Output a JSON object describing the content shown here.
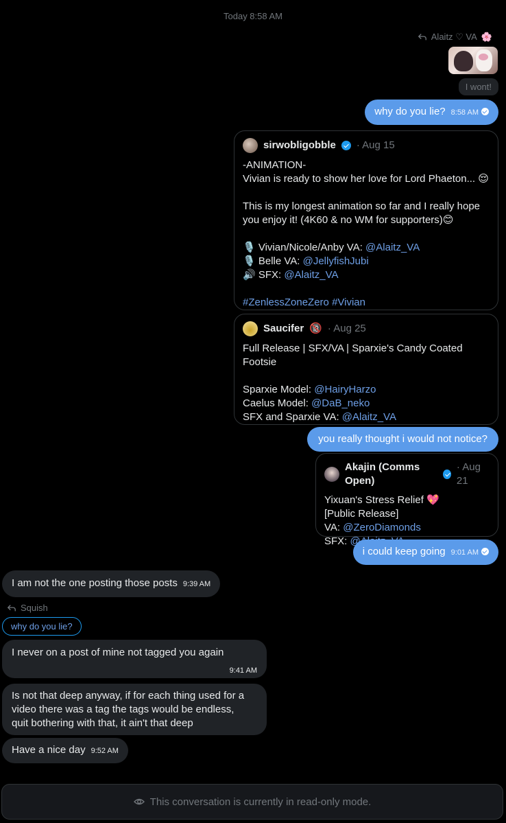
{
  "timestamp_header": "Today 8:58 AM",
  "reply1": {
    "label": "Alaitz ♡ VA",
    "emoji": "🌸",
    "reaction": "I wont!"
  },
  "msg1": {
    "text": "why do you lie?",
    "time": "8:58 AM"
  },
  "card1": {
    "name": "sirwobligobble",
    "date": "· Aug 15",
    "lines": [
      "-ANIMATION-",
      "Vivian is ready to show her love for Lord Phaeton... 😌",
      "",
      "This is my longest animation so far and I really hope",
      "you enjoy it! (4K60 & no WM for supporters)😊",
      "",
      "🎙️ Vivian/Nicole/Anby VA: ",
      "🎙️ Belle VA: ",
      "🔊 SFX: ",
      ""
    ],
    "mentions": [
      "@Alaitz_VA",
      "@JellyfishJubi",
      "@Alaitz_VA"
    ],
    "hashtags": "#ZenlessZoneZero #Vivian"
  },
  "card2": {
    "name": "Saucifer",
    "badge": "🔞",
    "date": "· Aug 25",
    "title1": "Full Release | SFX/VA | Sparxie's Candy Coated",
    "title2": "Footsie",
    "rows": [
      {
        "label": "Sparxie Model: ",
        "mention": "@HairyHarzo"
      },
      {
        "label": "Caelus Model: ",
        "mention": "@DaB_neko"
      },
      {
        "label": "SFX and Sparxie VA: ",
        "mention": "@Alaitz_VA"
      }
    ]
  },
  "msg2": {
    "text": "you really thought i would not notice?"
  },
  "card3": {
    "name": "Akajin (Comms Open)",
    "date": "· Aug 21",
    "line1": "Yixuan's Stress Relief 💖",
    "line2": "[Public Release]",
    "rows": [
      {
        "label": "VA: ",
        "mention": "@ZeroDiamonds"
      },
      {
        "label": "SFX: ",
        "mention": "@Alaitz_VA"
      }
    ]
  },
  "msg3": {
    "text": "i could keep going",
    "time": "9:01 AM"
  },
  "in1": {
    "text": "I am not the one posting those posts",
    "time": "9:39 AM"
  },
  "reply2": {
    "label": "Squish",
    "quote": "why do you lie?"
  },
  "in2": {
    "text": "I never on a post of mine not tagged you again",
    "time": "9:41 AM"
  },
  "in3": {
    "lines": [
      "Is not that deep anyway, if for each thing used for a",
      "video there was a tag the tags would be endless,",
      "quit bothering with that, it ain't that deep"
    ]
  },
  "in4": {
    "text": "Have a nice day",
    "time": "9:52 AM"
  },
  "footer": {
    "text": "This conversation is currently in read-only mode."
  },
  "colors": {
    "outgoing": "#5b9bea",
    "incoming": "#202327",
    "link": "#6e9fe6",
    "background": "#000000"
  }
}
